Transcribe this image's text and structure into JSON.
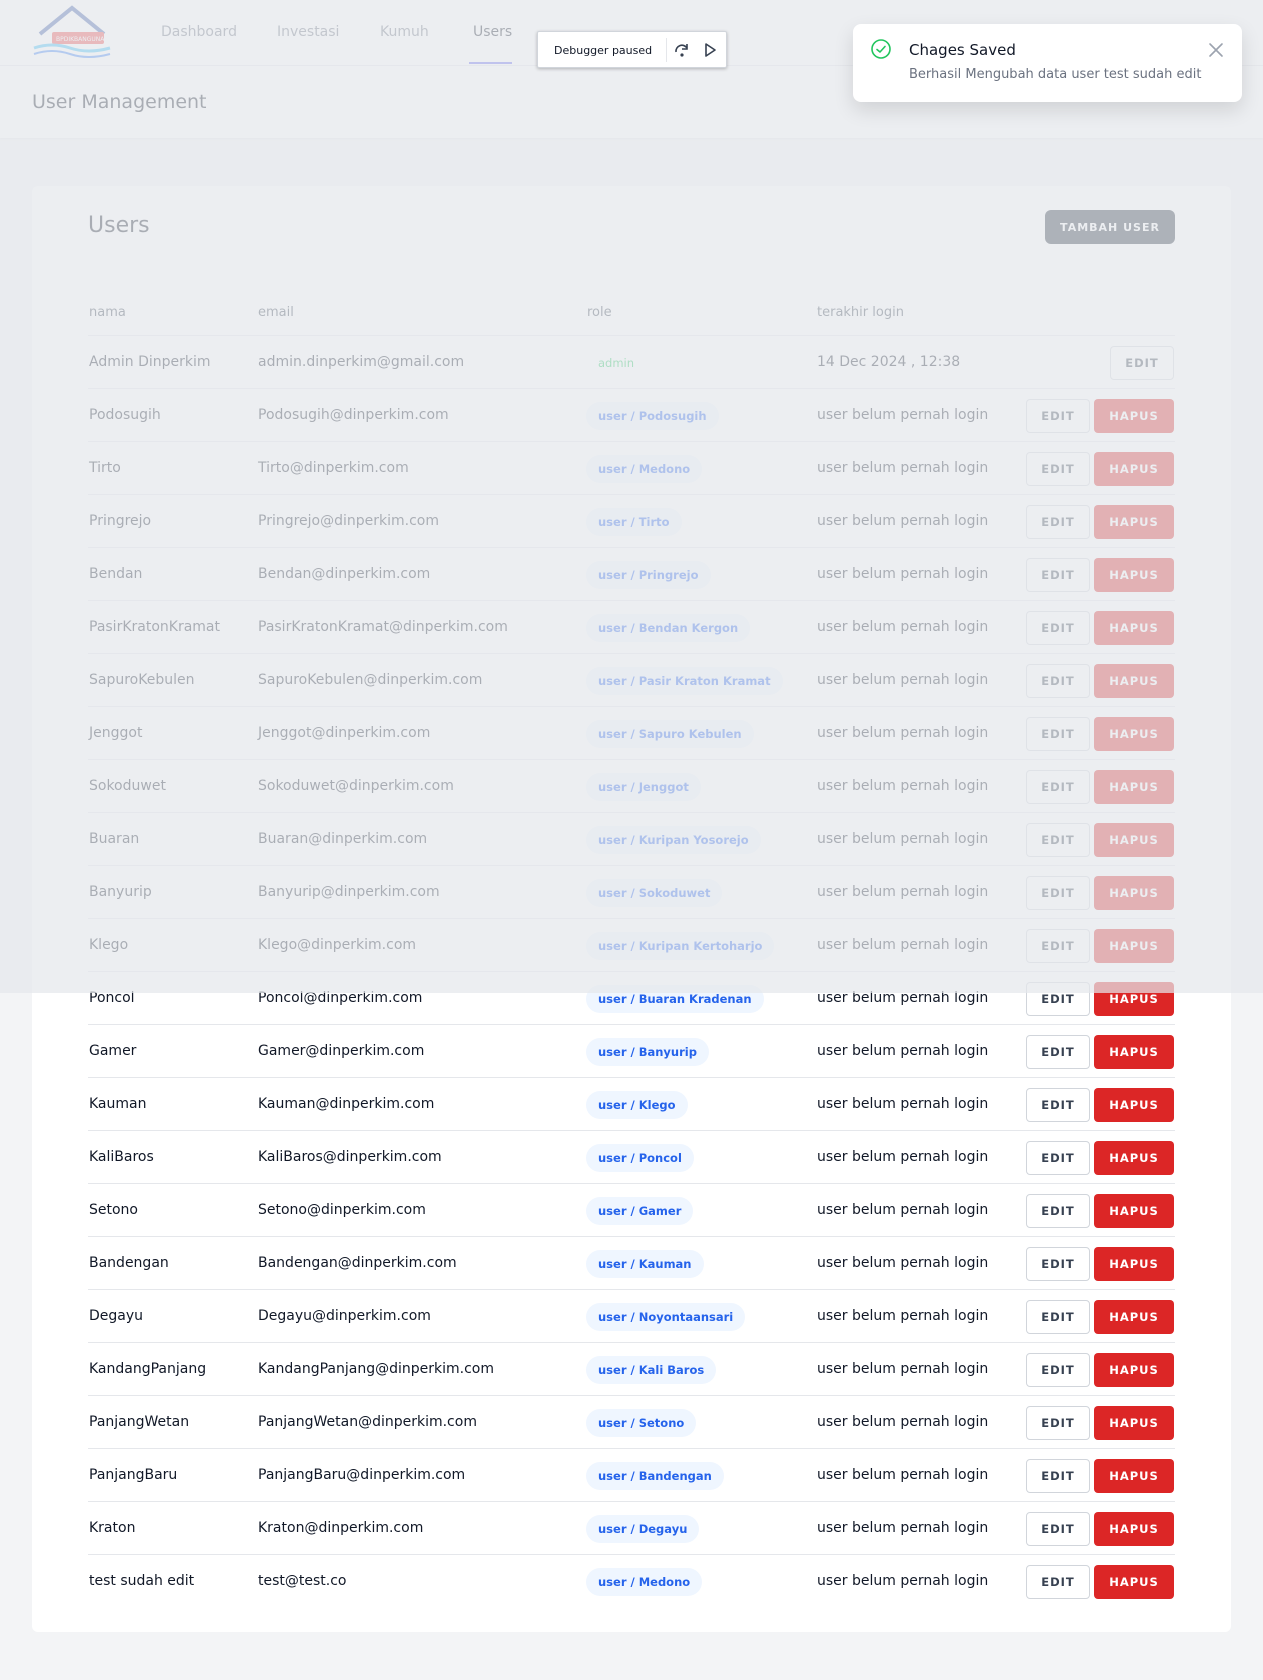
{
  "nav": {
    "logo_text": "BPDIKBANGUNAN",
    "links": [
      {
        "label": "Dashboard"
      },
      {
        "label": "Investasi"
      },
      {
        "label": "Kumuh"
      },
      {
        "label": "Users"
      }
    ],
    "active": "Users"
  },
  "debugger": {
    "label": "Debugger paused",
    "step_over_icon": "step-over-icon",
    "resume_icon": "resume-icon"
  },
  "header": {
    "title": "User Management"
  },
  "toast": {
    "icon": "check-circle-icon",
    "title": "Chages Saved",
    "message": "Berhasil Mengubah data user test sudah edit",
    "close_icon": "close-icon"
  },
  "card": {
    "title": "Users",
    "add_button": "TAMBAH USER"
  },
  "table": {
    "headers": {
      "nama": "nama",
      "email": "email",
      "role": "role",
      "login": "terakhir login"
    },
    "edit_label": "EDIT",
    "hapus_label": "HAPUS",
    "rows": [
      {
        "nama": "Admin Dinperkim",
        "email": "admin.dinperkim@gmail.com",
        "role": "admin",
        "login": "14 Dec 2024 , 12:38"
      },
      {
        "nama": "Podosugih",
        "email": "Podosugih@dinperkim.com",
        "role": "user / Podosugih",
        "login": "user belum pernah login"
      },
      {
        "nama": "Tirto",
        "email": "Tirto@dinperkim.com",
        "role": "user / Medono",
        "login": "user belum pernah login"
      },
      {
        "nama": "Pringrejo",
        "email": "Pringrejo@dinperkim.com",
        "role": "user / Tirto",
        "login": "user belum pernah login"
      },
      {
        "nama": "Bendan",
        "email": "Bendan@dinperkim.com",
        "role": "user / Pringrejo",
        "login": "user belum pernah login"
      },
      {
        "nama": "PasirKratonKramat",
        "email": "PasirKratonKramat@dinperkim.com",
        "role": "user / Bendan Kergon",
        "login": "user belum pernah login"
      },
      {
        "nama": "SapuroKebulen",
        "email": "SapuroKebulen@dinperkim.com",
        "role": "user / Pasir Kraton Kramat",
        "login": "user belum pernah login"
      },
      {
        "nama": "Jenggot",
        "email": "Jenggot@dinperkim.com",
        "role": "user / Sapuro Kebulen",
        "login": "user belum pernah login"
      },
      {
        "nama": "Sokoduwet",
        "email": "Sokoduwet@dinperkim.com",
        "role": "user / Jenggot",
        "login": "user belum pernah login"
      },
      {
        "nama": "Buaran",
        "email": "Buaran@dinperkim.com",
        "role": "user / Kuripan Yosorejo",
        "login": "user belum pernah login"
      },
      {
        "nama": "Banyurip",
        "email": "Banyurip@dinperkim.com",
        "role": "user / Sokoduwet",
        "login": "user belum pernah login"
      },
      {
        "nama": "Klego",
        "email": "Klego@dinperkim.com",
        "role": "user / Kuripan Kertoharjo",
        "login": "user belum pernah login"
      },
      {
        "nama": "Poncol",
        "email": "Poncol@dinperkim.com",
        "role": "user / Buaran Kradenan",
        "login": "user belum pernah login"
      },
      {
        "nama": "Gamer",
        "email": "Gamer@dinperkim.com",
        "role": "user / Banyurip",
        "login": "user belum pernah login"
      },
      {
        "nama": "Kauman",
        "email": "Kauman@dinperkim.com",
        "role": "user / Klego",
        "login": "user belum pernah login"
      },
      {
        "nama": "KaliBaros",
        "email": "KaliBaros@dinperkim.com",
        "role": "user / Poncol",
        "login": "user belum pernah login"
      },
      {
        "nama": "Setono",
        "email": "Setono@dinperkim.com",
        "role": "user / Gamer",
        "login": "user belum pernah login"
      },
      {
        "nama": "Bandengan",
        "email": "Bandengan@dinperkim.com",
        "role": "user / Kauman",
        "login": "user belum pernah login"
      },
      {
        "nama": "Degayu",
        "email": "Degayu@dinperkim.com",
        "role": "user / Noyontaansari",
        "login": "user belum pernah login"
      },
      {
        "nama": "KandangPanjang",
        "email": "KandangPanjang@dinperkim.com",
        "role": "user / Kali Baros",
        "login": "user belum pernah login"
      },
      {
        "nama": "PanjangWetan",
        "email": "PanjangWetan@dinperkim.com",
        "role": "user / Setono",
        "login": "user belum pernah login"
      },
      {
        "nama": "PanjangBaru",
        "email": "PanjangBaru@dinperkim.com",
        "role": "user / Bandengan",
        "login": "user belum pernah login"
      },
      {
        "nama": "Kraton",
        "email": "Kraton@dinperkim.com",
        "role": "user / Degayu",
        "login": "user belum pernah login"
      },
      {
        "nama": "test sudah edit",
        "email": "test@test.co",
        "role": "user / Medono",
        "login": "user belum pernah login"
      }
    ]
  },
  "colors": {
    "primary_dark": "#1f2937",
    "danger": "#dc2626",
    "badge_bg": "#eff6ff",
    "badge_text": "#2563eb",
    "admin_badge_text": "#22c55e",
    "success_icon": "#22c55e",
    "nav_active_underline": "#6366f1"
  }
}
